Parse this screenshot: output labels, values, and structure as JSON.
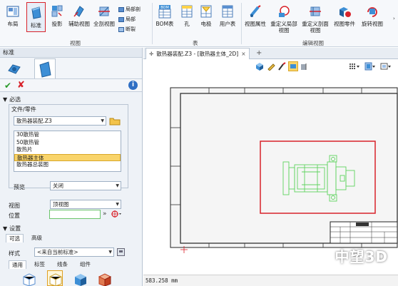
{
  "ribbon": {
    "buttons": [
      {
        "id": "layout",
        "label": "布局"
      },
      {
        "id": "standard",
        "label": "标准",
        "selected": true
      },
      {
        "id": "projection",
        "label": "投影"
      },
      {
        "id": "aux",
        "label": "辅助视图"
      },
      {
        "id": "fullsection",
        "label": "全剖视图"
      },
      {
        "id": "bom",
        "label": "BOM表",
        "badge": "BOM"
      },
      {
        "id": "hole",
        "label": "孔"
      },
      {
        "id": "electrode",
        "label": "电极"
      },
      {
        "id": "usertable",
        "label": "用户表"
      },
      {
        "id": "viewprops",
        "label": "视图属性"
      },
      {
        "id": "redefpartial",
        "label": "重定义局部\n视图"
      },
      {
        "id": "redefsection",
        "label": "重定义剖面\n视图"
      },
      {
        "id": "viewpart",
        "label": "视图零件"
      },
      {
        "id": "rotateview",
        "label": "旋转视图"
      }
    ],
    "small_buttons": [
      "局部剖",
      "局部",
      "断裂"
    ],
    "groups": {
      "view": "视图",
      "table": "表",
      "edit_view": "编辑视图"
    }
  },
  "panel": {
    "title": "标准",
    "required_section": "必选",
    "file_part_label": "文件/零件",
    "file_combo_value": "散热器装配.Z3",
    "parts": [
      "30散热管",
      "50散热管",
      "散热片",
      "散热器主体",
      "散热器总装图"
    ],
    "selected_part_index": 3,
    "preview_label": "预览",
    "preview_value": "关闭",
    "view_label": "视图",
    "view_value": "顶视图",
    "position_label": "位置",
    "position_value": "",
    "settings_section": "设置",
    "tabs": [
      "可选",
      "高级"
    ],
    "style_label": "样式",
    "style_value": "<来自当前标准>",
    "subtabs": [
      "通用",
      "标签",
      "线条",
      "组件"
    ]
  },
  "document": {
    "tab_label": "散热器装配.Z3 - [散热器主体_2D]",
    "tab_close": "×",
    "tab_add": "+",
    "status_coords": "583.258 mm"
  },
  "brand": "中望3D",
  "colors": {
    "selection_red": "#d8222a",
    "part_green": "#5fd35f",
    "list_highlight": "#f9d46a"
  }
}
